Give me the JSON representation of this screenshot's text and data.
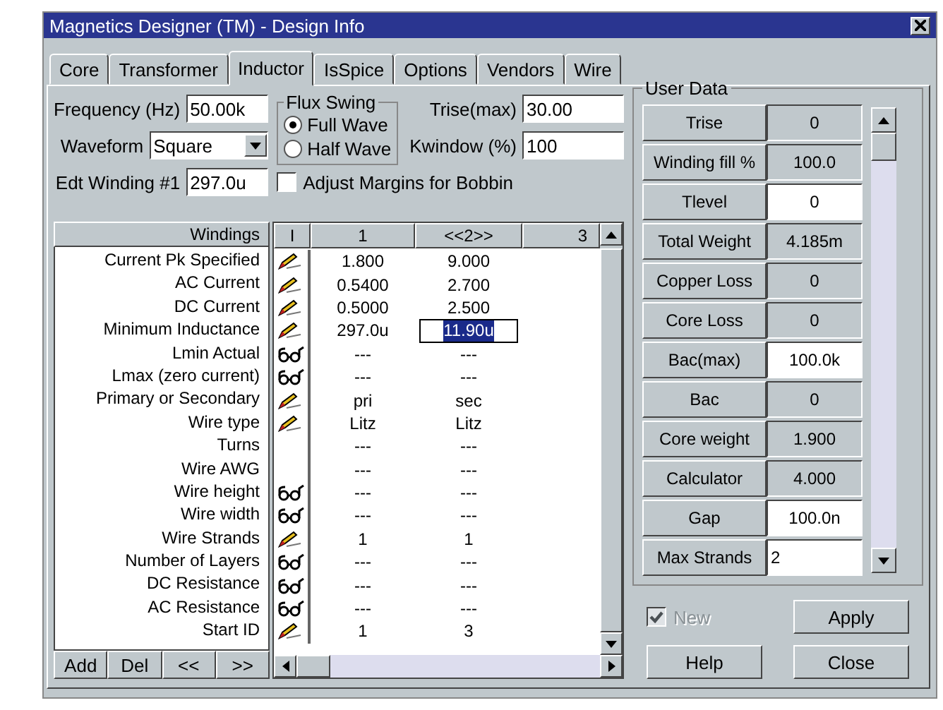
{
  "window": {
    "title": "Magnetics Designer (TM) - Design Info"
  },
  "tabs": [
    {
      "label": "Core",
      "selected": false
    },
    {
      "label": "Transformer",
      "selected": false
    },
    {
      "label": "Inductor",
      "selected": true
    },
    {
      "label": "IsSpice",
      "selected": false
    },
    {
      "label": "Options",
      "selected": false
    },
    {
      "label": "Vendors",
      "selected": false
    },
    {
      "label": "Wire",
      "selected": false
    }
  ],
  "frequency": {
    "label": "Frequency (Hz)",
    "value": "50.00k"
  },
  "waveform": {
    "label": "Waveform",
    "value": "Square"
  },
  "edt_winding": {
    "label": "Edt Winding #1",
    "value": "297.0u"
  },
  "flux_swing": {
    "title": "Flux Swing",
    "options": [
      {
        "label": "Full Wave",
        "selected": true
      },
      {
        "label": "Half Wave",
        "selected": false
      }
    ]
  },
  "trise_max": {
    "label": "Trise(max)",
    "value": "30.00"
  },
  "kwindow": {
    "label": "Kwindow (%)",
    "value": "100"
  },
  "adjust_margins": {
    "label": "Adjust Margins for Bobbin",
    "checked": false
  },
  "windings": {
    "header": "Windings",
    "columns": [
      "I",
      "1",
      "<<2>>",
      "3"
    ],
    "rows": [
      {
        "label": "Current Pk Specified",
        "kind": "edit",
        "values": [
          "1.800",
          "9.000"
        ]
      },
      {
        "label": "AC Current",
        "kind": "edit",
        "values": [
          "0.5400",
          "2.700"
        ]
      },
      {
        "label": "DC Current",
        "kind": "edit",
        "values": [
          "0.5000",
          "2.500"
        ]
      },
      {
        "label": "Minimum Inductance",
        "kind": "edit",
        "values": [
          "297.0u",
          "11.90u"
        ],
        "cell_selected": [
          false,
          true
        ]
      },
      {
        "label": "Lmin Actual",
        "kind": "view",
        "values": [
          "---",
          "---"
        ]
      },
      {
        "label": "Lmax (zero current)",
        "kind": "view",
        "values": [
          "---",
          "---"
        ]
      },
      {
        "label": "Primary or Secondary",
        "kind": "edit",
        "values": [
          "pri",
          "sec"
        ]
      },
      {
        "label": "Wire type",
        "kind": "edit",
        "values": [
          "Litz",
          "Litz"
        ]
      },
      {
        "label": "Turns",
        "kind": "none",
        "values": [
          "---",
          "---"
        ]
      },
      {
        "label": "Wire AWG",
        "kind": "none",
        "values": [
          "---",
          "---"
        ]
      },
      {
        "label": "Wire height",
        "kind": "view",
        "values": [
          "---",
          "---"
        ]
      },
      {
        "label": "Wire width",
        "kind": "view",
        "values": [
          "---",
          "---"
        ]
      },
      {
        "label": "Wire Strands",
        "kind": "edit",
        "values": [
          "1",
          "1"
        ]
      },
      {
        "label": "Number of Layers",
        "kind": "view",
        "values": [
          "---",
          "---"
        ]
      },
      {
        "label": "DC Resistance",
        "kind": "view",
        "values": [
          "---",
          "---"
        ]
      },
      {
        "label": "AC Resistance",
        "kind": "view",
        "values": [
          "---",
          "---"
        ]
      },
      {
        "label": "Start ID",
        "kind": "edit",
        "values": [
          "1",
          "3"
        ]
      }
    ],
    "buttons": [
      "Add",
      "Del",
      "<<",
      ">>"
    ]
  },
  "user_data": {
    "title": "User Data",
    "rows": [
      {
        "label": "Trise",
        "value": "0",
        "kind": "readonly"
      },
      {
        "label": "Winding fill %",
        "value": "100.0",
        "kind": "readonly"
      },
      {
        "label": "Tlevel",
        "value": "0",
        "kind": "editable"
      },
      {
        "label": "Total Weight",
        "value": "4.185m",
        "kind": "readonly"
      },
      {
        "label": "Copper Loss",
        "value": "0",
        "kind": "readonly"
      },
      {
        "label": "Core Loss",
        "value": "0",
        "kind": "readonly"
      },
      {
        "label": "Bac(max)",
        "value": "100.0k",
        "kind": "editable"
      },
      {
        "label": "Bac",
        "value": "0",
        "kind": "readonly"
      },
      {
        "label": "Core weight",
        "value": "1.900",
        "kind": "readonly"
      },
      {
        "label": "Calculator",
        "value": "4.000",
        "kind": "readonly"
      },
      {
        "label": "Gap",
        "value": "100.0n",
        "kind": "editable"
      },
      {
        "label": "Max Strands",
        "value": "2",
        "kind": "text"
      }
    ]
  },
  "new": {
    "label": "New",
    "checked": true,
    "disabled": true
  },
  "buttons": [
    "Apply",
    "Help",
    "Close"
  ]
}
